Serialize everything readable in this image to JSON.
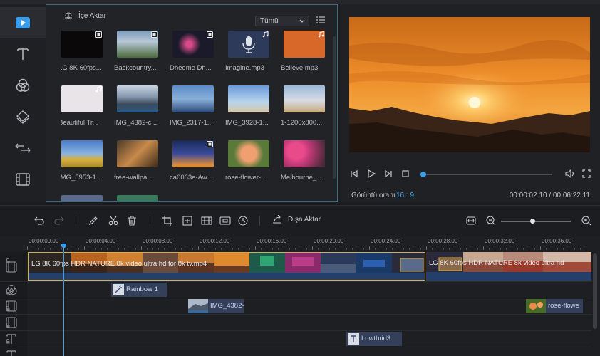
{
  "media": {
    "import_label": "İçe Aktar",
    "filter_value": "Tümü",
    "items": [
      {
        "label": "LG 8K 60fps...",
        "kind": "video"
      },
      {
        "label": "Backcountry...",
        "kind": "video"
      },
      {
        "label": "Dheeme Dh...",
        "kind": "video"
      },
      {
        "label": "Imagine.mp3",
        "kind": "audio"
      },
      {
        "label": "Believe.mp3",
        "kind": "audio"
      },
      {
        "label": "Beautiful Tr...",
        "kind": "audio"
      },
      {
        "label": "IMG_4382-c...",
        "kind": "image"
      },
      {
        "label": "IMG_2317-1...",
        "kind": "image"
      },
      {
        "label": "IMG_3928-1...",
        "kind": "image"
      },
      {
        "label": "1-1200x800...",
        "kind": "image"
      },
      {
        "label": "IMG_5953-1...",
        "kind": "image"
      },
      {
        "label": "free-wallpa...",
        "kind": "image"
      },
      {
        "label": "ca0063e-Aw...",
        "kind": "video"
      },
      {
        "label": "rose-flower-...",
        "kind": "image"
      },
      {
        "label": "Melbourne_...",
        "kind": "image"
      }
    ]
  },
  "preview": {
    "ratio_label": "Görüntü oranı",
    "ratio_value": "16 : 9",
    "time": "00:00:02.10 / 00:06:22.11",
    "progress": 0.005
  },
  "toolbar": {
    "export_label": "Dışa Aktar",
    "zoom_level": 0.45
  },
  "timeline": {
    "ruler": [
      "00:00:00.00",
      "00:00:04.00",
      "00:00:08.00",
      "00:00:12.00",
      "00:00:16.00",
      "00:00:20.00",
      "00:00:24.00",
      "00:00:28.00",
      "00:00:32.00",
      "00:00:36.00"
    ],
    "video_clip_1": "LG 8K 60fps HDR NATURE 8k video ultra hd for 8k tv.mp4",
    "video_clip_2": "LG 8K 60fps HDR NATURE 8k video ultra hd",
    "effect_clip": "Rainbow 1",
    "image_clip_1": "IMG_4382-",
    "image_clip_2": "rose-flowe",
    "text_clip": "Lowthrid3"
  },
  "colors": {
    "accent": "#3aa0ee",
    "panel_border": "#3a6a8a"
  }
}
